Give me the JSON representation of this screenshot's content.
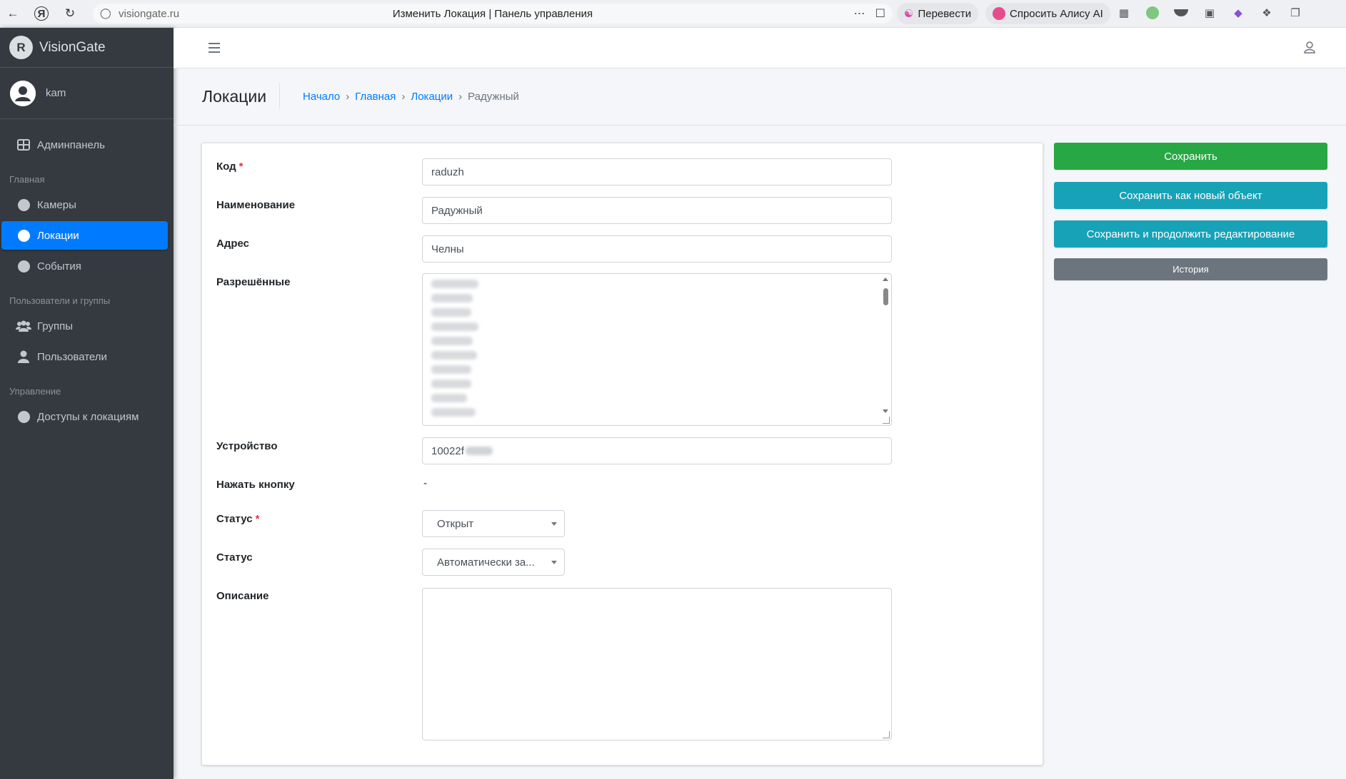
{
  "browser": {
    "url": "visiongate.ru",
    "tab_title": "Изменить Локация | Панель управления",
    "translate_label": "Перевести",
    "alice_label": "Спросить Алису AI"
  },
  "sidebar": {
    "brand": "VisionGate",
    "user": "kam",
    "dashboard_label": "Админпанель",
    "sections": {
      "main": "Главная",
      "users_groups": "Пользователи и группы",
      "management": "Управление"
    },
    "items": {
      "cameras": "Камеры",
      "locations": "Локации",
      "events": "События",
      "groups": "Группы",
      "users": "Пользователи",
      "location_access": "Доступы к локациям"
    }
  },
  "header": {
    "page_title": "Локации",
    "breadcrumb": [
      "Начало",
      "Главная",
      "Локации",
      "Радужный"
    ],
    "breadcrumb_sep": "›"
  },
  "form": {
    "code_label": "Код",
    "code_value": "raduzh",
    "name_label": "Наименование",
    "name_value": "Радужный",
    "address_label": "Адрес",
    "address_value": "Челны",
    "allowed_label": "Разрешённые",
    "device_label": "Устройство",
    "device_value": "10022f",
    "press_button_label": "Нажать кнопку",
    "press_button_value": "-",
    "status1_label": "Статус",
    "status1_value": "Открыт",
    "status2_label": "Статус",
    "status2_value": "Автоматически за...",
    "description_label": "Описание",
    "required_mark": "*"
  },
  "actions": {
    "save": "Сохранить",
    "save_as_new": "Сохранить как новый объект",
    "save_continue": "Сохранить и продолжить редактирование",
    "history": "История"
  },
  "colors": {
    "sidebar_bg": "#343a40",
    "active": "#007bff",
    "success": "#28a745",
    "info": "#17a2b8",
    "secondary": "#6c757d"
  }
}
